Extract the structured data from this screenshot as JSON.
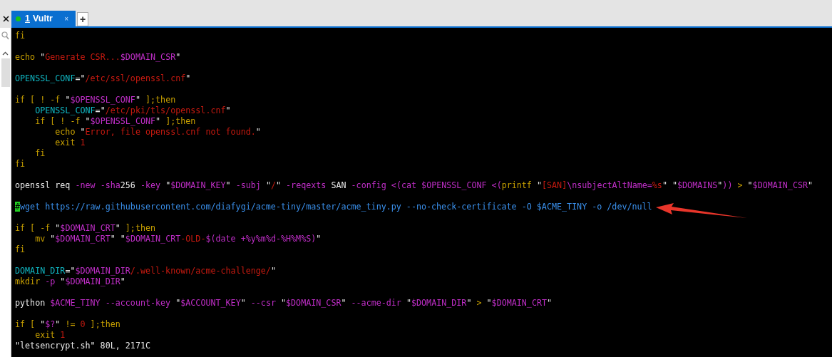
{
  "tabs": [
    {
      "hotkey": "1",
      "label": "Vultr",
      "selected": true,
      "color": "#17c217",
      "close": "×"
    }
  ],
  "new_tab": "+",
  "terminal": {
    "lines": [
      {
        "segments": [
          {
            "kind": "keyword",
            "text": "fi"
          }
        ]
      },
      {
        "kind": "blank"
      },
      {
        "segments": [
          {
            "kind": "keyword",
            "text": "echo "
          },
          {
            "kind": "plain",
            "text": "\""
          },
          {
            "kind": "string",
            "text": "Generate CSR..."
          },
          {
            "kind": "variable",
            "text": "$DOMAIN_CSR"
          },
          {
            "kind": "plain",
            "text": "\""
          }
        ]
      },
      {
        "kind": "blank"
      },
      {
        "segments": [
          {
            "kind": "name",
            "text": "OPENSSL_CONF"
          },
          {
            "kind": "plain",
            "text": "=\""
          },
          {
            "kind": "string",
            "text": "/etc/ssl/openssl.cnf"
          },
          {
            "kind": "plain",
            "text": "\""
          }
        ]
      },
      {
        "kind": "blank"
      },
      {
        "segments": [
          {
            "kind": "keyword",
            "text": "if [ ! -f "
          },
          {
            "kind": "plain",
            "text": "\""
          },
          {
            "kind": "variable",
            "text": "$OPENSSL_CONF"
          },
          {
            "kind": "plain",
            "text": "\""
          },
          {
            "kind": "keyword",
            "text": " ];then"
          }
        ]
      },
      {
        "segments": [
          {
            "kind": "name",
            "text": "    OPENSSL_CONF"
          },
          {
            "kind": "plain",
            "text": "=\""
          },
          {
            "kind": "string",
            "text": "/etc/pki/tls/openssl.cnf"
          },
          {
            "kind": "plain",
            "text": "\""
          }
        ]
      },
      {
        "segments": [
          {
            "kind": "keyword",
            "text": "    if [ ! -f "
          },
          {
            "kind": "plain",
            "text": "\""
          },
          {
            "kind": "variable",
            "text": "$OPENSSL_CONF"
          },
          {
            "kind": "plain",
            "text": "\""
          },
          {
            "kind": "keyword",
            "text": " ];then"
          }
        ]
      },
      {
        "segments": [
          {
            "kind": "keyword",
            "text": "        echo "
          },
          {
            "kind": "plain",
            "text": "\""
          },
          {
            "kind": "string",
            "text": "Error, file openssl.cnf not found."
          },
          {
            "kind": "plain",
            "text": "\""
          }
        ]
      },
      {
        "segments": [
          {
            "kind": "keyword",
            "text": "        exit "
          },
          {
            "kind": "string",
            "text": "1"
          }
        ]
      },
      {
        "segments": [
          {
            "kind": "keyword",
            "text": "    fi"
          }
        ]
      },
      {
        "segments": [
          {
            "kind": "keyword",
            "text": "fi"
          }
        ]
      },
      {
        "kind": "blank"
      },
      {
        "segments": [
          {
            "kind": "plain",
            "text": "openssl req "
          },
          {
            "kind": "variable",
            "text": "-new -sha"
          },
          {
            "kind": "plain",
            "text": "256 "
          },
          {
            "kind": "variable",
            "text": "-key "
          },
          {
            "kind": "plain",
            "text": "\""
          },
          {
            "kind": "variable",
            "text": "$DOMAIN_KEY"
          },
          {
            "kind": "plain",
            "text": "\" "
          },
          {
            "kind": "variable",
            "text": "-subj "
          },
          {
            "kind": "plain",
            "text": "\""
          },
          {
            "kind": "string",
            "text": "/"
          },
          {
            "kind": "plain",
            "text": "\" "
          },
          {
            "kind": "variable",
            "text": "-reqexts "
          },
          {
            "kind": "plain",
            "text": "SAN "
          },
          {
            "kind": "variable",
            "text": "-config <(cat $OPENSSL_CONF <("
          },
          {
            "kind": "keyword",
            "text": "printf "
          },
          {
            "kind": "plain",
            "text": "\""
          },
          {
            "kind": "string",
            "text": "[SAN]"
          },
          {
            "kind": "variable",
            "text": "\\nsubjectAltName="
          },
          {
            "kind": "string",
            "text": "%s"
          },
          {
            "kind": "plain",
            "text": "\" \""
          },
          {
            "kind": "variable",
            "text": "$DOMAINS"
          },
          {
            "kind": "plain",
            "text": "\""
          },
          {
            "kind": "variable",
            "text": "))"
          },
          {
            "kind": "keyword",
            "text": " > "
          },
          {
            "kind": "plain",
            "text": "\""
          },
          {
            "kind": "variable",
            "text": "$DOMAIN_CSR"
          },
          {
            "kind": "plain",
            "text": "\""
          }
        ]
      },
      {
        "kind": "blank"
      },
      {
        "segments": [
          {
            "kind": "cursor",
            "text": "#"
          },
          {
            "kind": "url",
            "text": "wget https://raw.githubusercontent.com/diafygi/acme-tiny/master/acme_tiny.py --no-check-certificate -O $ACME_TINY -o /dev/null"
          }
        ]
      },
      {
        "kind": "blank"
      },
      {
        "segments": [
          {
            "kind": "keyword",
            "text": "if [ -f "
          },
          {
            "kind": "plain",
            "text": "\""
          },
          {
            "kind": "variable",
            "text": "$DOMAIN_CRT"
          },
          {
            "kind": "plain",
            "text": "\""
          },
          {
            "kind": "keyword",
            "text": " ];then"
          }
        ]
      },
      {
        "segments": [
          {
            "kind": "keyword",
            "text": "    mv "
          },
          {
            "kind": "plain",
            "text": "\""
          },
          {
            "kind": "variable",
            "text": "$DOMAIN_CRT"
          },
          {
            "kind": "plain",
            "text": "\" \""
          },
          {
            "kind": "variable",
            "text": "$DOMAIN_CRT"
          },
          {
            "kind": "string",
            "text": "-OLD-"
          },
          {
            "kind": "variable",
            "text": "$(date +%y%m%d-%H%M%S)"
          },
          {
            "kind": "plain",
            "text": "\""
          }
        ]
      },
      {
        "segments": [
          {
            "kind": "keyword",
            "text": "fi"
          }
        ]
      },
      {
        "kind": "blank"
      },
      {
        "segments": [
          {
            "kind": "name",
            "text": "DOMAIN_DIR"
          },
          {
            "kind": "plain",
            "text": "=\""
          },
          {
            "kind": "variable",
            "text": "$DOMAIN_DIR"
          },
          {
            "kind": "string",
            "text": "/.well-known/acme-challenge/"
          },
          {
            "kind": "plain",
            "text": "\""
          }
        ]
      },
      {
        "segments": [
          {
            "kind": "keyword",
            "text": "mkdir "
          },
          {
            "kind": "variable",
            "text": "-p "
          },
          {
            "kind": "plain",
            "text": "\""
          },
          {
            "kind": "variable",
            "text": "$DOMAIN_DIR"
          },
          {
            "kind": "plain",
            "text": "\""
          }
        ]
      },
      {
        "kind": "blank"
      },
      {
        "segments": [
          {
            "kind": "plain",
            "text": "python "
          },
          {
            "kind": "variable",
            "text": "$ACME_TINY --account-key "
          },
          {
            "kind": "plain",
            "text": "\""
          },
          {
            "kind": "variable",
            "text": "$ACCOUNT_KEY"
          },
          {
            "kind": "plain",
            "text": "\" "
          },
          {
            "kind": "variable",
            "text": "--csr "
          },
          {
            "kind": "plain",
            "text": "\""
          },
          {
            "kind": "variable",
            "text": "$DOMAIN_CSR"
          },
          {
            "kind": "plain",
            "text": "\" "
          },
          {
            "kind": "variable",
            "text": "--acme-dir "
          },
          {
            "kind": "plain",
            "text": "\""
          },
          {
            "kind": "variable",
            "text": "$DOMAIN_DIR"
          },
          {
            "kind": "plain",
            "text": "\" "
          },
          {
            "kind": "keyword",
            "text": "> "
          },
          {
            "kind": "plain",
            "text": "\""
          },
          {
            "kind": "variable",
            "text": "$DOMAIN_CRT"
          },
          {
            "kind": "plain",
            "text": "\""
          }
        ]
      },
      {
        "kind": "blank"
      },
      {
        "segments": [
          {
            "kind": "keyword",
            "text": "if [ "
          },
          {
            "kind": "plain",
            "text": "\""
          },
          {
            "kind": "variable",
            "text": "$?"
          },
          {
            "kind": "plain",
            "text": "\" "
          },
          {
            "kind": "keyword",
            "text": "!= "
          },
          {
            "kind": "string",
            "text": "0"
          },
          {
            "kind": "keyword",
            "text": " ];then"
          }
        ]
      },
      {
        "segments": [
          {
            "kind": "keyword",
            "text": "    exit "
          },
          {
            "kind": "string",
            "text": "1"
          }
        ]
      },
      {
        "segments": [
          {
            "kind": "plain",
            "text": "\"letsencrypt.sh\" 80L, 2171C"
          }
        ]
      }
    ]
  }
}
